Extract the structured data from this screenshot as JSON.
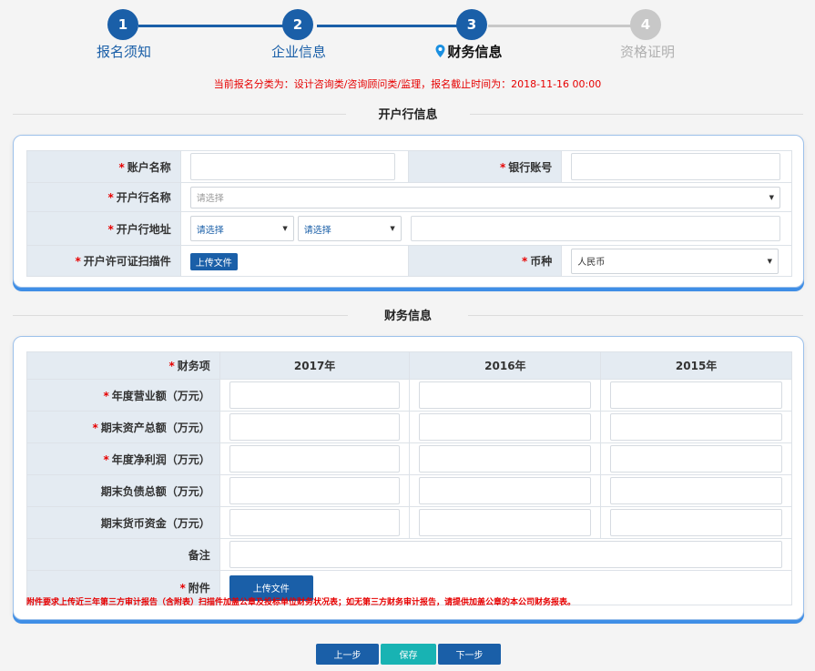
{
  "steps": [
    {
      "number": "1",
      "label": "报名须知",
      "state": "done"
    },
    {
      "number": "2",
      "label": "企业信息",
      "state": "done"
    },
    {
      "number": "3",
      "label": "财务信息",
      "state": "active"
    },
    {
      "number": "4",
      "label": "资格证明",
      "state": "pending"
    }
  ],
  "notice": "当前报名分类为：设计咨询类/咨询顾问类/监理，报名截止时间为：2018-11-16 00:00",
  "bank_section": {
    "title": "开户行信息",
    "account_name_label": "账户名称",
    "account_number_label": "银行账号",
    "bank_name_label": "开户行名称",
    "bank_name_placeholder": "请选择",
    "bank_address_label": "开户行地址",
    "province_placeholder": "请选择",
    "city_placeholder": "请选择",
    "license_label": "开户许可证扫描件",
    "upload_label": "上传文件",
    "currency_label": "币种",
    "currency_value": "人民币"
  },
  "finance_section": {
    "title": "财务信息",
    "header_label": "财务项",
    "years": [
      "2017年",
      "2016年",
      "2015年"
    ],
    "rows": [
      {
        "label": "年度营业额（万元）",
        "required": "*"
      },
      {
        "label": "期末资产总额（万元）",
        "required": "*"
      },
      {
        "label": "年度净利润（万元）",
        "required": "*"
      },
      {
        "label": "期末负债总额（万元）",
        "required": ""
      },
      {
        "label": "期末货币资金（万元）",
        "required": ""
      }
    ],
    "remark_label": "备注",
    "attachment_label": "附件",
    "upload_label": "上传文件",
    "footnote": "附件要求上传近三年第三方审计报告（含附表）扫描件加盖公章及投标单位财务状况表；如无第三方财务审计报告，请提供加盖公章的本公司财务报表。"
  },
  "buttons": {
    "prev": "上一步",
    "save": "保存",
    "next": "下一步"
  },
  "required_mark": "*",
  "colors": {
    "primary": "#1a5fa8",
    "teal": "#18b3b3",
    "required": "#e60000",
    "inactive": "#c8c8c8"
  }
}
